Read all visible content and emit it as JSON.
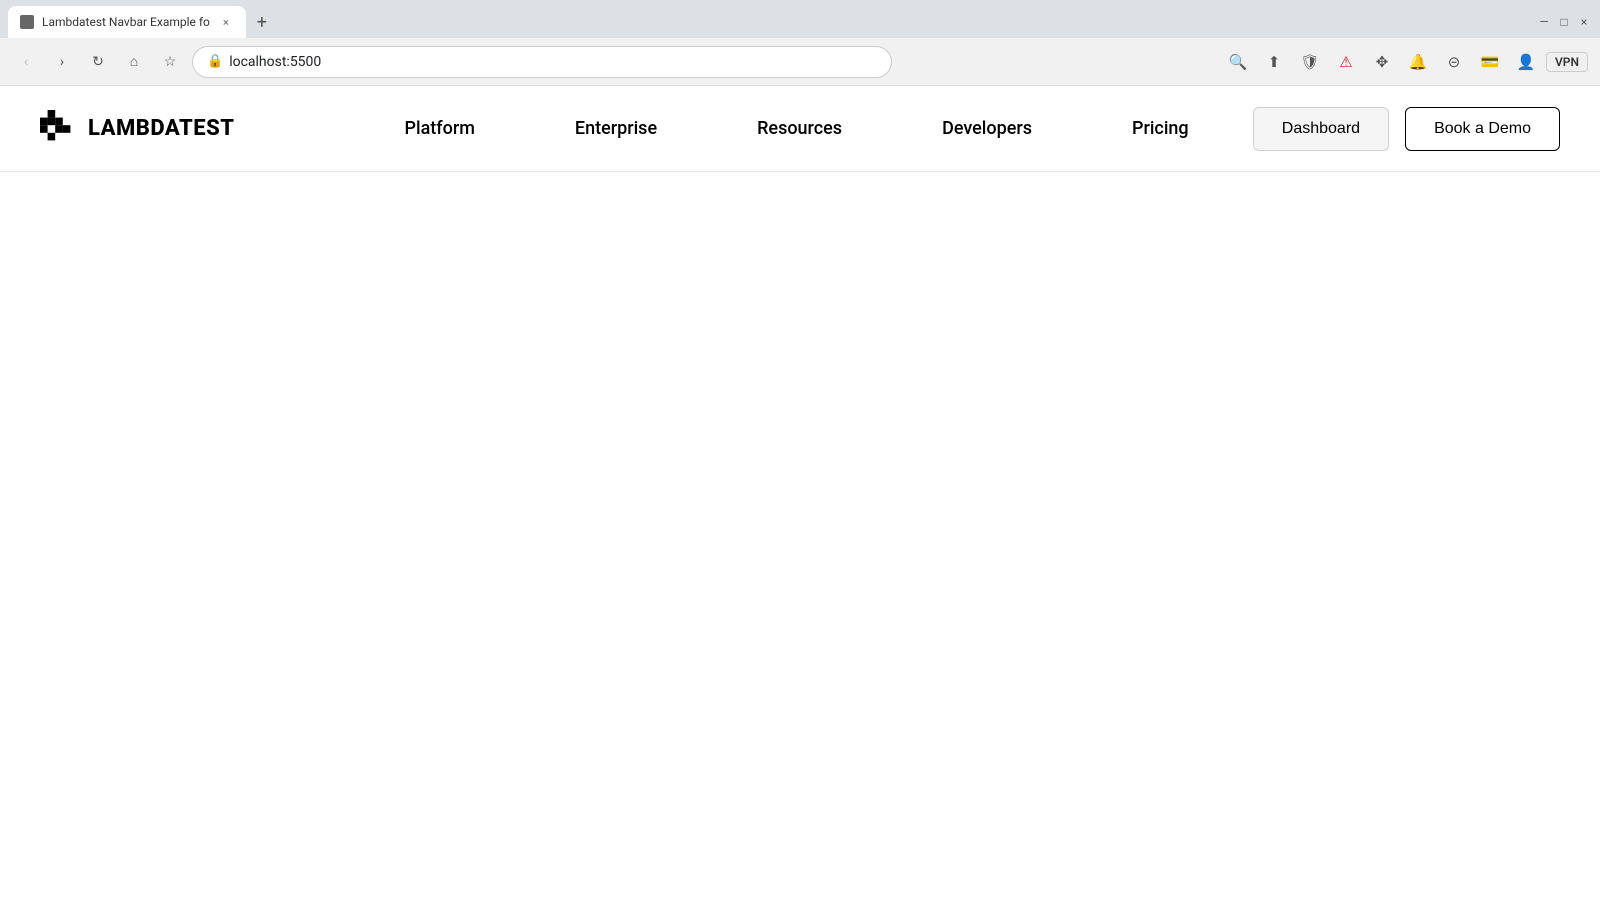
{
  "browser": {
    "tab": {
      "title": "Lambdatest Navbar Example fo",
      "close_label": "×"
    },
    "new_tab_label": "+",
    "window_controls": {
      "minimize": "—",
      "maximize": "□",
      "close": "×"
    },
    "address_bar": {
      "url": "localhost:5500",
      "lock_icon": "🔒"
    },
    "actions": {
      "search_icon": "🔍",
      "share_icon": "⬆",
      "shield_icon": "🛡",
      "alert_icon": "⚠",
      "extensions_icon": "🧩",
      "notifications_icon": "🔔",
      "sidebar_icon": "⊟",
      "wallet_icon": "💳",
      "profile_icon": "👤",
      "vpn_label": "VPN"
    }
  },
  "navbar": {
    "logo_text": "LAMBDATEST",
    "nav_links": [
      {
        "label": "Platform",
        "id": "platform"
      },
      {
        "label": "Enterprise",
        "id": "enterprise"
      },
      {
        "label": "Resources",
        "id": "resources"
      },
      {
        "label": "Developers",
        "id": "developers"
      },
      {
        "label": "Pricing",
        "id": "pricing"
      }
    ],
    "dashboard_label": "Dashboard",
    "book_demo_label": "Book a Demo"
  }
}
